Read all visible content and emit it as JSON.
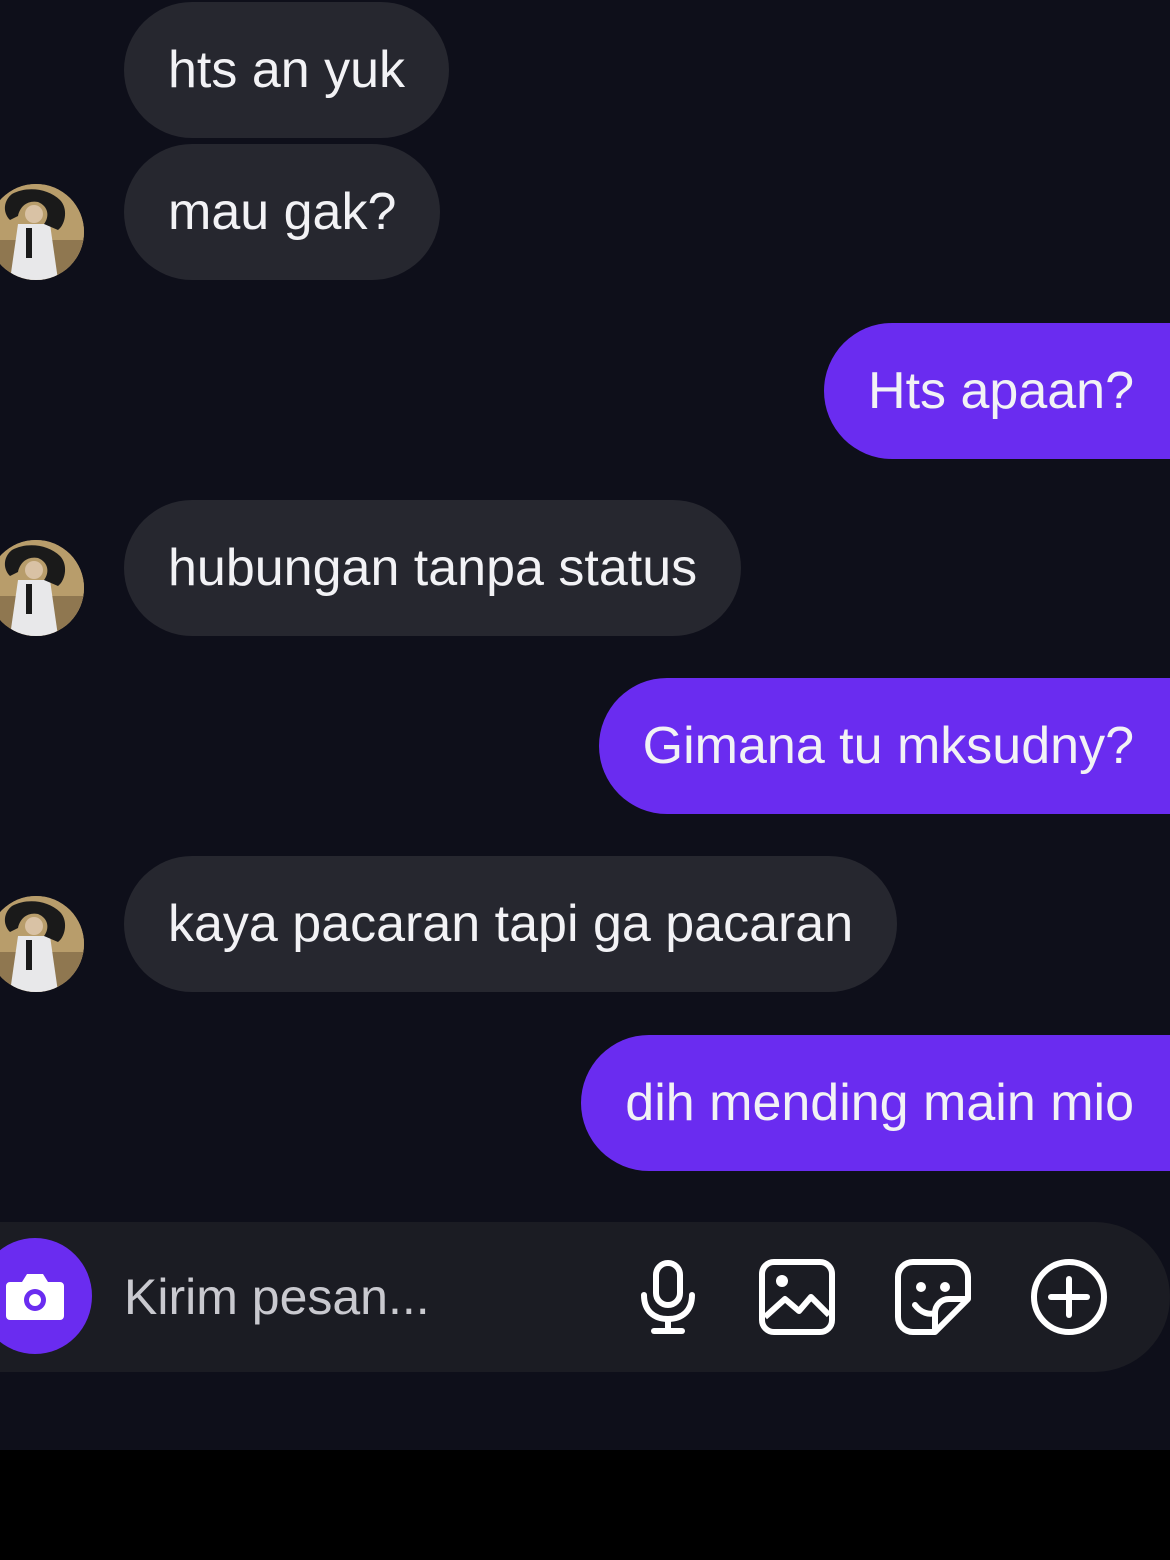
{
  "chat": {
    "messages": [
      {
        "direction": "incoming",
        "text": "hts an yuk"
      },
      {
        "direction": "incoming",
        "text": "mau gak?",
        "avatar": true
      },
      {
        "direction": "outgoing",
        "text": "Hts apaan?"
      },
      {
        "direction": "incoming",
        "text": "hubungan tanpa status",
        "avatar": true
      },
      {
        "direction": "outgoing",
        "text": "Gimana tu mksudny?"
      },
      {
        "direction": "incoming",
        "text": "kaya pacaran tapi ga pacaran",
        "avatar": true
      },
      {
        "direction": "outgoing",
        "text": "dih mending main mio"
      }
    ]
  },
  "composer": {
    "placeholder": "Kirim pesan...",
    "icons": [
      "camera-icon",
      "microphone-icon",
      "image-icon",
      "sticker-icon",
      "plus-circle-icon"
    ]
  },
  "colors": {
    "background": "#0e0f1a",
    "incoming_bubble": "#26272f",
    "outgoing_bubble": "#6a2cf0",
    "text": "#f2f2f5",
    "composer_bg": "#1b1c23"
  }
}
